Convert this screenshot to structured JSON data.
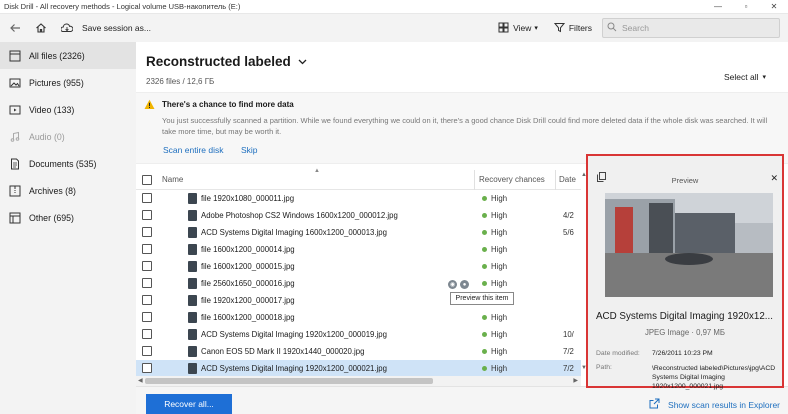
{
  "window": {
    "title": "Disk Drill - All recovery methods - Logical volume USB-накопитель (E:)",
    "minimize": "—",
    "restore": "▫",
    "close": "✕"
  },
  "toolbar": {
    "back_icon": "arrow-left-icon",
    "home_icon": "home-icon",
    "save_icon": "save-session-icon",
    "save_label": "Save session as...",
    "view_label": "View",
    "filters_label": "Filters",
    "search_placeholder": "Search"
  },
  "sidebar": {
    "items": [
      {
        "label": "All files (2326)",
        "icon": "files-icon",
        "active": true,
        "disabled": false
      },
      {
        "label": "Pictures (955)",
        "icon": "picture-icon",
        "active": false,
        "disabled": false
      },
      {
        "label": "Video (133)",
        "icon": "video-icon",
        "active": false,
        "disabled": false
      },
      {
        "label": "Audio (0)",
        "icon": "music-icon",
        "active": false,
        "disabled": true
      },
      {
        "label": "Documents (535)",
        "icon": "document-icon",
        "active": false,
        "disabled": false
      },
      {
        "label": "Archives (8)",
        "icon": "archive-icon",
        "active": false,
        "disabled": false
      },
      {
        "label": "Other (695)",
        "icon": "other-icon",
        "active": false,
        "disabled": false
      }
    ]
  },
  "main": {
    "title": "Reconstructed labeled",
    "subtitle": "2326 files / 12,6 ГБ",
    "select_all": "Select all"
  },
  "banner": {
    "title": "There's a chance to find more data",
    "text": "You just successfully scanned a partition. While we found everything we could on it, there's a good chance Disk Drill could find more deleted data if the whole disk was searched. It will take more time, but may be worth it.",
    "scan_entire": "Scan entire disk",
    "skip": "Skip"
  },
  "table": {
    "columns": {
      "name": "Name",
      "chances": "Recovery chances",
      "date": "Date"
    },
    "rows": [
      {
        "name": "file 1920x1080_000011.jpg",
        "chance": "High",
        "date": "",
        "selected": false
      },
      {
        "name": "Adobe Photoshop CS2 Windows 1600x1200_000012.jpg",
        "chance": "High",
        "date": "4/2",
        "selected": false
      },
      {
        "name": "ACD Systems Digital Imaging 1600x1200_000013.jpg",
        "chance": "High",
        "date": "5/6",
        "selected": false
      },
      {
        "name": "file 1600x1200_000014.jpg",
        "chance": "High",
        "date": "",
        "selected": false
      },
      {
        "name": "file 1600x1200_000015.jpg",
        "chance": "High",
        "date": "",
        "selected": false
      },
      {
        "name": "file 2560x1650_000016.jpg",
        "chance": "High",
        "date": "",
        "selected": false
      },
      {
        "name": "file 1920x1200_000017.jpg",
        "chance": "High",
        "date": "",
        "selected": false
      },
      {
        "name": "file 1600x1200_000018.jpg",
        "chance": "High",
        "date": "",
        "selected": false
      },
      {
        "name": "ACD Systems Digital Imaging 1920x1200_000019.jpg",
        "chance": "High",
        "date": "10/",
        "selected": false
      },
      {
        "name": "Canon EOS 5D Mark II 1920x1440_000020.jpg",
        "chance": "High",
        "date": "7/2",
        "selected": false
      },
      {
        "name": "ACD Systems Digital Imaging 1920x1200_000021.jpg",
        "chance": "High",
        "date": "7/2",
        "selected": true
      }
    ],
    "tooltip": "Preview this item"
  },
  "footer": {
    "recover_label": "Recover all...",
    "explorer_label": "Show scan results in Explorer"
  },
  "preview": {
    "title": "Preview",
    "name": "ACD Systems Digital Imaging 1920x12...",
    "meta": "JPEG Image · 0,97 МБ",
    "date_label": "Date modified:",
    "date_value": "7/26/2011 10:23 PM",
    "path_label": "Path:",
    "path_value": "\\Reconstructed labeled\\Pictures\\jpg\\ACD Systems Digital Imaging 1920x1200_000021.jpg"
  },
  "colors": {
    "accent": "#1e6fd6",
    "link": "#1e6fbf",
    "high": "#6ab04c",
    "highlight_box": "#d93535",
    "selected_row": "#cfe3f7"
  }
}
